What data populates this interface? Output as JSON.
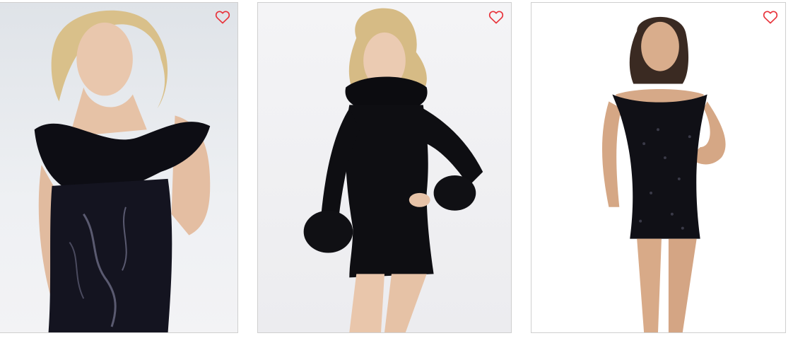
{
  "products": [
    {
      "image": "black-feather-off-shoulder-sequin-dress-photo",
      "wishlist_icon": "heart-outline-icon"
    },
    {
      "image": "black-velvet-feather-cuff-long-sleeve-dress-photo",
      "wishlist_icon": "heart-outline-icon"
    },
    {
      "image": "black-sequin-off-shoulder-mini-dress-photo",
      "wishlist_icon": "heart-outline-icon"
    }
  ],
  "colors": {
    "wishlist_heart": "#e8323a",
    "card_border": "#cfcfcf",
    "background": "#ffffff"
  }
}
